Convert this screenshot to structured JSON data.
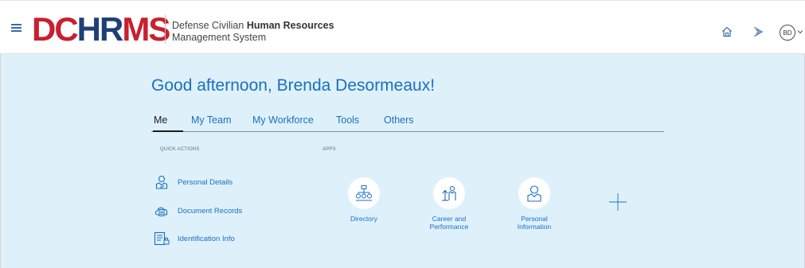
{
  "header": {
    "logo_part1": "DC",
    "logo_part2": "HR",
    "logo_part3": "MS",
    "system_line1_prefix": "Defense Civilian",
    "system_line1_bold": "Human Resources",
    "system_line2": "Management System",
    "avatar_initials": "BD"
  },
  "greeting": "Good afternoon, Brenda Desormeaux!",
  "tabs": [
    {
      "label": "Me",
      "active": true
    },
    {
      "label": "My Team",
      "active": false
    },
    {
      "label": "My Workforce",
      "active": false
    },
    {
      "label": "Tools",
      "active": false
    },
    {
      "label": "Others",
      "active": false
    }
  ],
  "quick_actions": {
    "title": "QUICK ACTIONS",
    "items": [
      {
        "label": "Personal Details",
        "icon": "person-icon"
      },
      {
        "label": "Document Records",
        "icon": "cloud-document-icon"
      },
      {
        "label": "Identification Info",
        "icon": "id-card-icon"
      }
    ]
  },
  "apps": {
    "title": "APPS",
    "items": [
      {
        "label_line1": "Directory",
        "label_line2": "",
        "icon": "org-chart-icon"
      },
      {
        "label_line1": "Career and",
        "label_line2": "Performance",
        "icon": "career-icon"
      },
      {
        "label_line1": "Personal",
        "label_line2": "Information",
        "icon": "person-icon"
      }
    ]
  },
  "colors": {
    "accent_blue": "#1b6ec2",
    "logo_red": "#c8202f",
    "logo_navy": "#1f3f78",
    "main_bg": "#def1fb"
  }
}
